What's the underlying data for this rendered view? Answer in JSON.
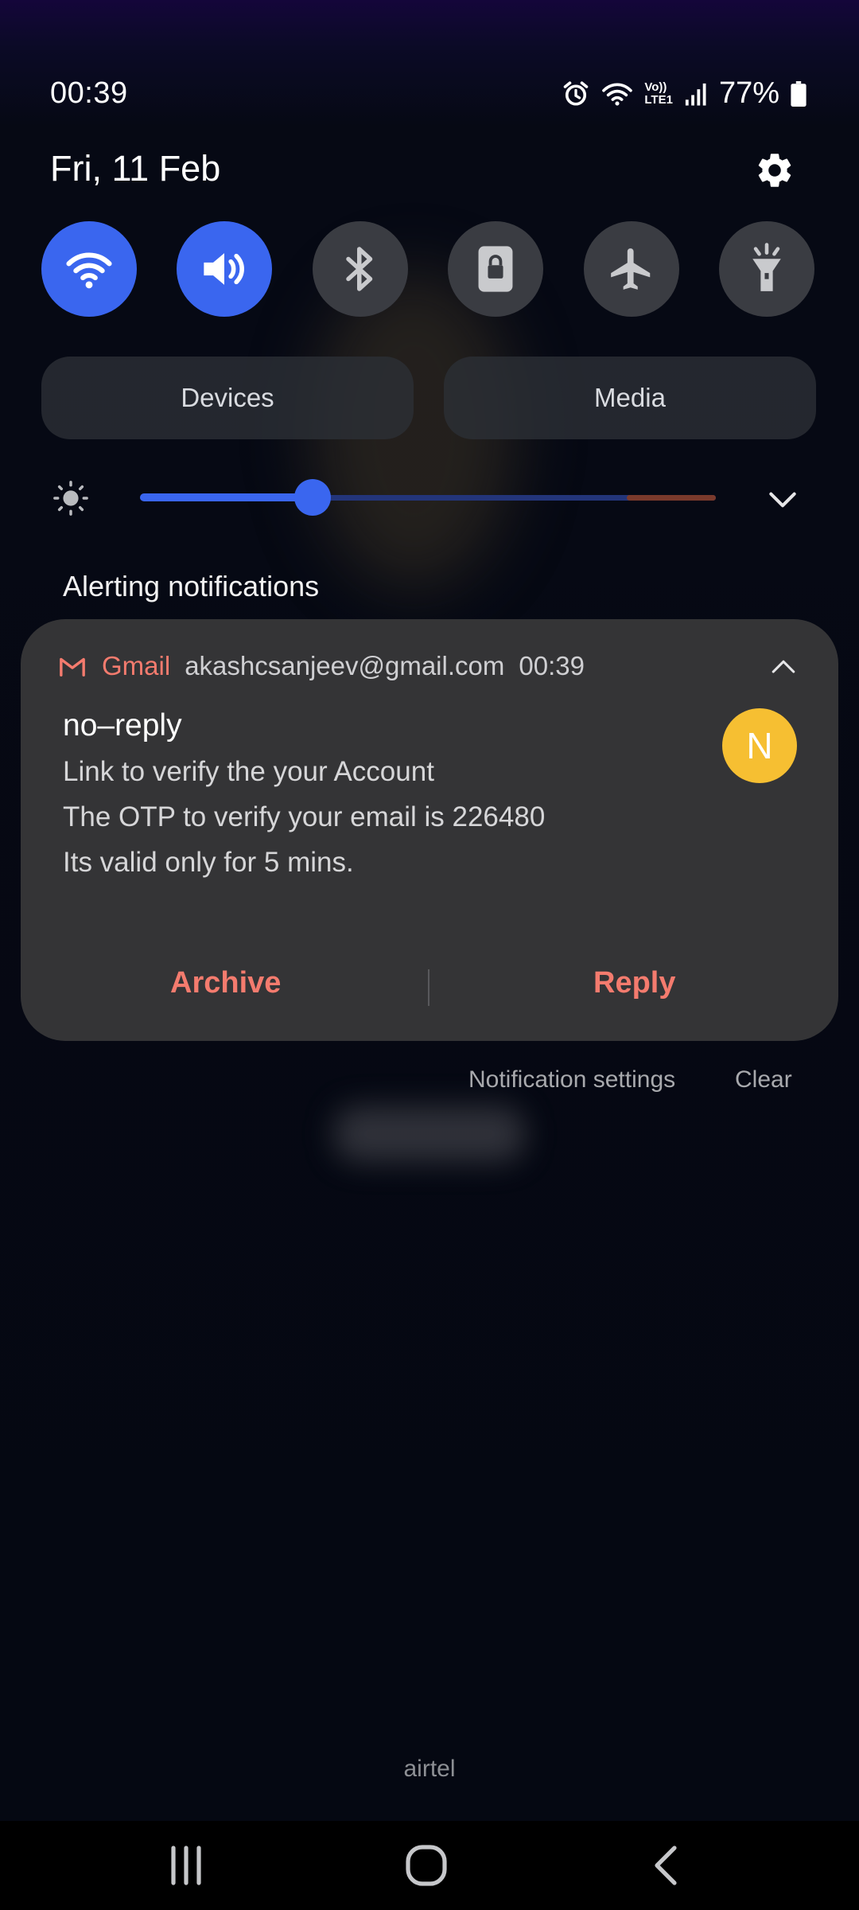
{
  "status_bar": {
    "time": "00:39",
    "volte_top": "Vo))",
    "volte_bottom": "LTE1",
    "battery": "77%"
  },
  "header": {
    "date": "Fri, 11 Feb",
    "settings_icon": "gear-icon"
  },
  "quick_toggles": [
    {
      "name": "wifi",
      "icon": "wifi-icon",
      "on": true
    },
    {
      "name": "sound",
      "icon": "volume-icon",
      "on": true
    },
    {
      "name": "bluetooth",
      "icon": "bluetooth-icon",
      "on": false
    },
    {
      "name": "rotation-lock",
      "icon": "lock-icon",
      "on": false
    },
    {
      "name": "airplane",
      "icon": "airplane-icon",
      "on": false
    },
    {
      "name": "flashlight",
      "icon": "flashlight-icon",
      "on": false
    }
  ],
  "panels": {
    "devices_label": "Devices",
    "media_label": "Media"
  },
  "brightness": {
    "level": 0.3
  },
  "notifications": {
    "section_title": "Alerting notifications",
    "card": {
      "app": "Gmail",
      "account": "akashcsanjeev@gmail.com",
      "time": "00:39",
      "sender": "no–reply",
      "avatar_letter": "N",
      "lines": [
        "Link to verify the your Account",
        "The OTP to verify your email is 226480",
        "Its valid only for 5 mins."
      ],
      "actions": {
        "archive": "Archive",
        "reply": "Reply"
      }
    },
    "settings_link": "Notification settings",
    "clear_link": "Clear"
  },
  "carrier": "airtel",
  "colors": {
    "accent": "#3a66ef",
    "gmail_red": "#f47b6e",
    "avatar": "#f6bf32"
  }
}
